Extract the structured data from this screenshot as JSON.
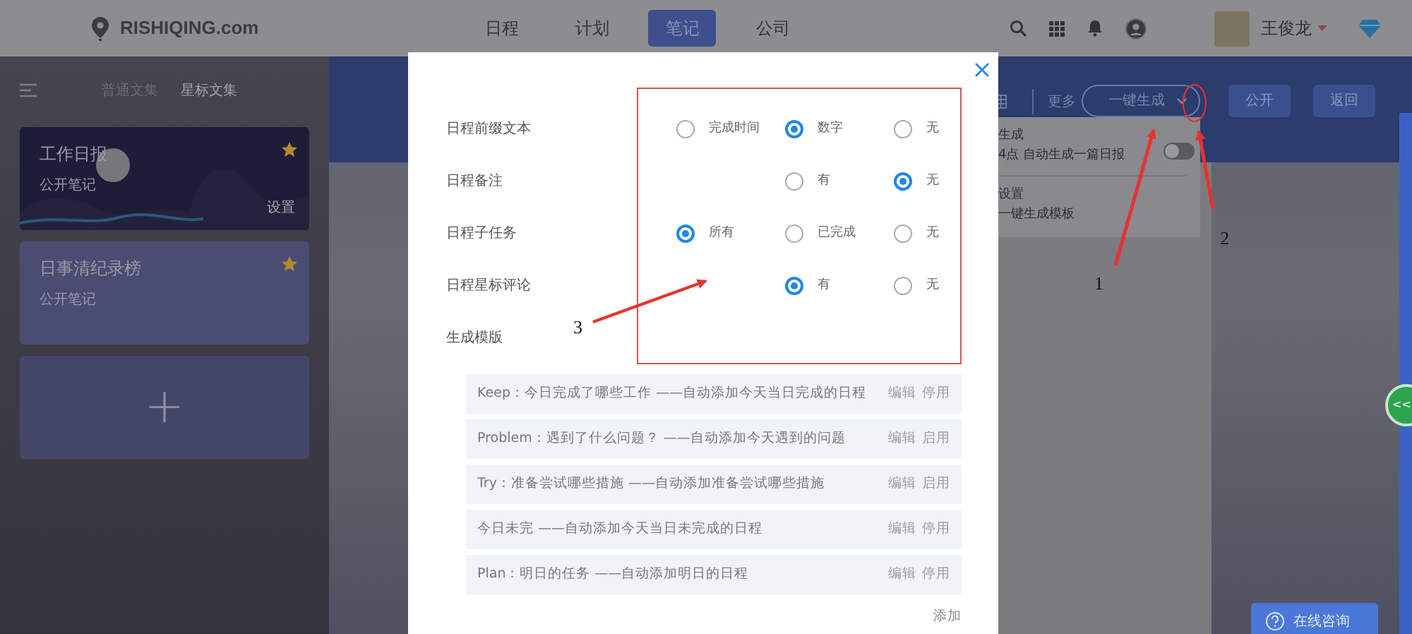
{
  "header": {
    "logo": "RISHIQING.com",
    "nav": [
      {
        "label": "日程",
        "selected": false
      },
      {
        "label": "计划",
        "selected": false
      },
      {
        "label": "笔记",
        "selected": true
      },
      {
        "label": "公司",
        "selected": false
      }
    ],
    "user": "王俊龙"
  },
  "sidebar": {
    "tabs": [
      {
        "label": "普通文集",
        "selected": false
      },
      {
        "label": "星标文集",
        "selected": true
      }
    ],
    "notebooks": [
      {
        "kind": "night",
        "title": "工作日报",
        "subtitle": "公开笔记",
        "action": "设置",
        "starred": true
      },
      {
        "kind": "plain",
        "title": "日事清纪录榜",
        "subtitle": "公开笔记",
        "starred": true
      }
    ],
    "add_label": "+"
  },
  "toolbar": {
    "more": "更多",
    "generate": "一键生成",
    "buttons": [
      "公开",
      "返回"
    ]
  },
  "dropdown": {
    "items": [
      {
        "title": "生成",
        "desc": "4点 自动生成一篇日报",
        "toggle": false
      },
      {
        "title": "设置",
        "desc": "一键生成模板"
      }
    ]
  },
  "modal": {
    "settings": [
      {
        "label": "日程前缀文本",
        "kind": "three-option",
        "options": [
          {
            "label": "完成时间",
            "selected": false
          },
          {
            "label": "数字",
            "selected": true
          },
          {
            "label": "无",
            "selected": false
          }
        ]
      },
      {
        "label": "日程备注",
        "kind": "two-option",
        "options": [
          {
            "label": "有",
            "selected": false
          },
          {
            "label": "无",
            "selected": true
          }
        ]
      },
      {
        "label": "日程子任务",
        "kind": "three-option",
        "options": [
          {
            "label": "所有",
            "selected": true
          },
          {
            "label": "已完成",
            "selected": false
          },
          {
            "label": "无",
            "selected": false
          }
        ]
      },
      {
        "label": "日程星标评论",
        "kind": "two-option",
        "options": [
          {
            "label": "有",
            "selected": true
          },
          {
            "label": "无",
            "selected": false
          }
        ]
      }
    ],
    "template_heading": "生成模版",
    "templates": [
      {
        "text": "Keep：今日完成了哪些工作 ——自动添加今天当日完成的日程",
        "actions": [
          "编辑",
          "停用"
        ]
      },
      {
        "text": "Problem：遇到了什么问题？ ——自动添加今天遇到的问题",
        "actions": [
          "编辑",
          "启用"
        ]
      },
      {
        "text": "Try：准备尝试哪些措施 ——自动添加准备尝试哪些措施",
        "actions": [
          "编辑",
          "启用"
        ]
      },
      {
        "text": "今日未完 ——自动添加今天当日未完成的日程",
        "actions": [
          "编辑",
          "停用"
        ]
      },
      {
        "text": "Plan：明日的任务 ——自动添加明日的日程",
        "actions": [
          "编辑",
          "停用"
        ]
      }
    ],
    "add": "添加"
  },
  "annotations": [
    "1",
    "2",
    "3"
  ],
  "side_tab": "<<",
  "consult": "在线咨询"
}
